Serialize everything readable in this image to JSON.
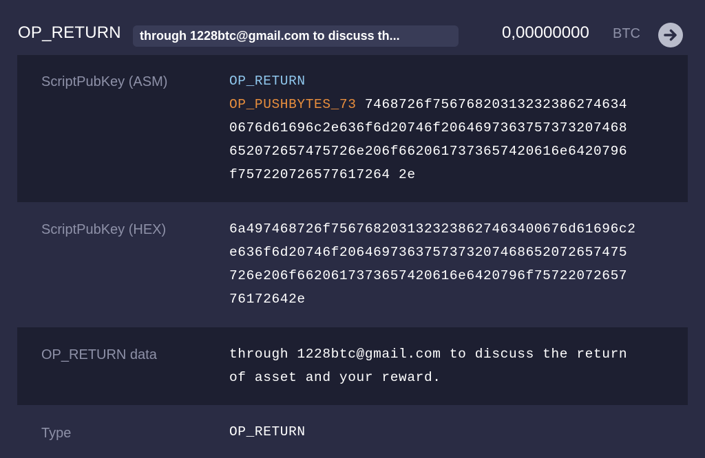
{
  "header": {
    "output_type": "OP_RETURN",
    "preview": "through 1228btc@gmail.com to discuss th...",
    "amount": "0,00000000",
    "unit": "BTC"
  },
  "rows": {
    "asm": {
      "label": "ScriptPubKey (ASM)",
      "op_return": "OP_RETURN",
      "push_op": "OP_PUSHBYTES_73",
      "push_data": "7468726f7567682031323238627463400676d61696c2e636f6d20746f2064697363757373207468652072657475726e206f662061737365742061 6e6420796f757220726577617264 2e",
      "lines": [
        "7468726f7567682031323238627463 4",
        "0676d61696c2e636f6d20746f2064697363757373207468",
        "652072657475726e206f6620617373657420616e6420796",
        "f757220726577617264 2e"
      ],
      "line1_rest": "7468726f756768203132323862746 34",
      "line2": "0676d61696c2e636f6d20746f2064697363757373207468",
      "line3": "652072657475726e206f6620617373657420616e6420796",
      "line4": "f757220726577617264 2e"
    },
    "hex": {
      "label": "ScriptPubKey (HEX)",
      "line1": "6a497468726f7567682031323238627463400676d61696c2",
      "line2": "e636f6d20746f2064697363757373207468652072657475",
      "line3": "726e206f6620617373657420616e6420796f75722072657",
      "line4": "76172642e"
    },
    "data": {
      "label": "OP_RETURN data",
      "line1": "through 1228btc@gmail.com to discuss the return",
      "line2": "of asset and your reward."
    },
    "type": {
      "label": "Type",
      "value": "OP_RETURN"
    }
  },
  "icons": {
    "arrow": "arrow-right-circle-icon"
  },
  "colors": {
    "background": "#2a2c44",
    "row_dark": "#1d1f31",
    "pill": "#393c57",
    "op_return_keyword": "#8fc6ec",
    "pushbytes_keyword": "#e88e3d",
    "label": "#8e91a8"
  }
}
